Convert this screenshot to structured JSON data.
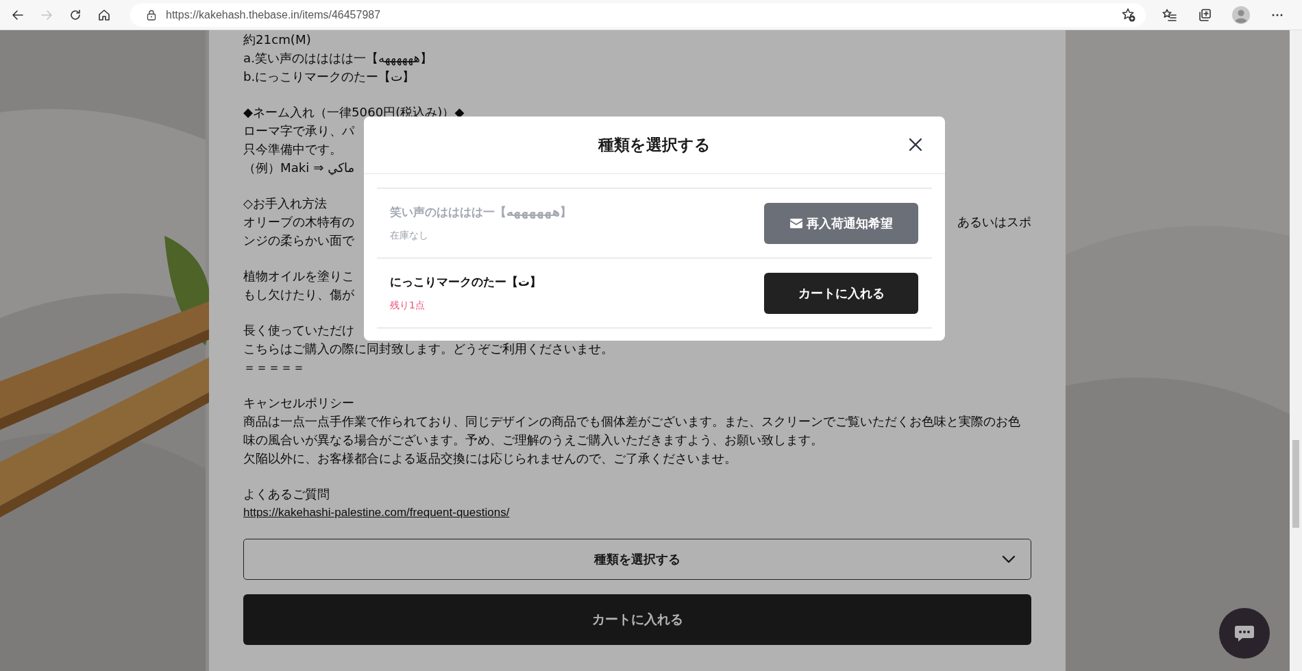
{
  "browser": {
    "url": "https://kakehash.thebase.in/items/46457987",
    "forward_disabled": true
  },
  "page": {
    "paragraphs": [
      [
        {
          "text": "約21cm(M)"
        },
        {
          "text": "a.笑い声のはははは一【ههههههه】"
        },
        {
          "text": "b.にっこりマークのたー【ت】"
        }
      ],
      [
        {
          "text": "◆ネーム入れ（一律5060円(税込み)）◆"
        },
        {
          "text": "ローマ字で承り、パ"
        },
        {
          "text": "只今準備中です。"
        },
        {
          "text": "（例）Maki ⇒ ماكي"
        }
      ],
      [
        {
          "text": "◇お手入れ方法"
        },
        {
          "text": "オリーブの木特有の",
          "right": "あるいはスポ"
        },
        {
          "text": "ンジの柔らかい面で"
        }
      ],
      [
        {
          "text": "植物オイルを塗りこ"
        },
        {
          "text": "もし欠けたり、傷が"
        }
      ],
      [
        {
          "text": "長く使っていただけ"
        },
        {
          "text": "こちらはご購入の際に同封致します。どうぞご利用くださいませ。"
        },
        {
          "text": "＝＝＝＝＝"
        }
      ],
      [
        {
          "text": "キャンセルポリシー"
        },
        {
          "text": "商品は一点一点手作業で作られており、同じデザインの商品でも個体差がございます。また、スクリーンでご覧いただくお色味と実際のお色味の風合いが異なる場合がございます。予め、ご理解のうえご購入いただきますよう、お願い致します。"
        },
        {
          "text": "欠陥以外に、お客様都合による返品交換には応じられませんので、ご了承くださいませ。"
        }
      ],
      [
        {
          "text": "よくあるご質問"
        },
        {
          "text": "https://kakehashi-palestine.com/frequent-questions/",
          "kind": "link"
        }
      ]
    ],
    "variant_select": {
      "label": "種類を選択する"
    },
    "cart_button": {
      "label": "カートに入れる"
    }
  },
  "dialog": {
    "title": "種類を選択する",
    "variants": [
      {
        "name": "笑い声のはははは一【ههههههه】",
        "stock": "在庫なし",
        "sold_out": true,
        "button": "再入荷通知希望"
      },
      {
        "name": "にっこりマークのたー【ت】",
        "stock": "残り1点",
        "sold_out": false,
        "button": "カートに入れる"
      }
    ]
  }
}
